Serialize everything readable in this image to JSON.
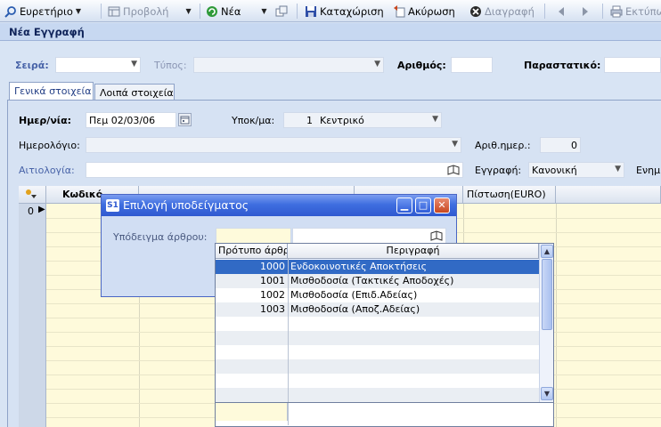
{
  "toolbar": {
    "items": [
      {
        "label": "Ευρετήριο",
        "icon": "search-icon"
      },
      {
        "label": "Προβολή",
        "icon": "view-icon"
      },
      {
        "label": "Νέα",
        "icon": "new-icon"
      },
      {
        "label": "",
        "icon": "copy-icon"
      },
      {
        "label": "Καταχώριση",
        "icon": "save-icon"
      },
      {
        "label": "Ακύρωση",
        "icon": "undo-icon"
      },
      {
        "label": "Διαγραφή",
        "icon": "delete-icon"
      },
      {
        "label": "",
        "icon": "prev-record-icon"
      },
      {
        "label": "",
        "icon": "next-record-icon"
      },
      {
        "label": "Εκτύπω",
        "icon": "printer-icon"
      }
    ]
  },
  "window": {
    "title": "Νέα Εγγραφή"
  },
  "header": {
    "seira_label": "Σειρά:",
    "typos_label": "Τύπος:",
    "arithmos_label": "Αριθμός:",
    "parastatiko_label": "Παραστατικό:"
  },
  "tabs": [
    {
      "label": "Γενικά στοιχεία",
      "active": true
    },
    {
      "label": "Λοιπά στοιχεία",
      "active": false
    }
  ],
  "form": {
    "date_label": "Ημερ/νία:",
    "date_value": "Πεμ 02/03/06",
    "ypok_label": "Υποκ/μα:",
    "ypok_code": "1",
    "ypok_name": "Κεντρικό",
    "hmerologio_label": "Ημερολόγιο:",
    "arith_hmer_label": "Αριθ.ημερ.:",
    "arith_hmer_value": "0",
    "aitiologia_label": "Αιτιολογία:",
    "eggrafi_label": "Εγγραφή:",
    "eggrafi_value": "Κανονική",
    "enim_label": "Ενημ"
  },
  "grid": {
    "columns": [
      "Κωδικό",
      "Πίστωση(EURO)"
    ],
    "row_number": "0"
  },
  "dialog": {
    "title": "Επιλογή υποδείγματος",
    "badge": "S1",
    "field_label": "Υπόδειγμα άρθρου:"
  },
  "lookup": {
    "columns": [
      "Πρότυπο άρθρ",
      "Περιγραφή"
    ],
    "rows": [
      {
        "code": "1000",
        "desc": "Ενδοκοινοτικές Αποκτήσεις",
        "selected": true
      },
      {
        "code": "1001",
        "desc": "Μισθοδοσία (Τακτικές Αποδοχές)",
        "selected": false
      },
      {
        "code": "1002",
        "desc": "Μισθοδοσία (Επιδ.Αδείας)",
        "selected": false
      },
      {
        "code": "1003",
        "desc": "Μισθοδοσία (Αποζ.Αδείας)",
        "selected": false
      }
    ]
  },
  "colors": {
    "accent": "#316ac5",
    "grid_bg": "#fefadb",
    "dialog_title": "#3f6ee0"
  }
}
